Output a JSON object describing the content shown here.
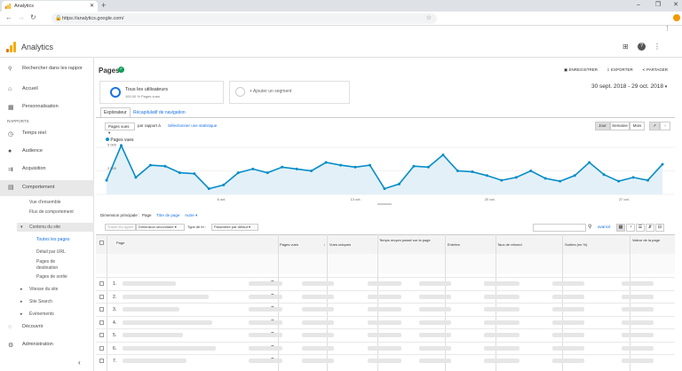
{
  "browser": {
    "tab_title": "Analytics",
    "new_tab": "+",
    "url": "https://analytics.google.com/"
  },
  "header": {
    "app_name": "Analytics"
  },
  "sidebar": {
    "search_placeholder": "Rechercher dans les rappor",
    "items": {
      "accueil": "Accueil",
      "personnalisation": "Personnalisation",
      "section_rapports": "RAPPORTS",
      "temps_reel": "Temps réel",
      "audience": "Audience",
      "acquisition": "Acquisition",
      "comportement": "Comportement",
      "vue_ensemble": "Vue d'ensemble",
      "flux_comportement": "Flux de comportement",
      "contenu_site": "Contenu du site",
      "toutes_pages": "Toutes les pages",
      "detail_url": "Détail par URL",
      "pages_destination": "Pages de destination",
      "pages_sortie": "Pages de sortie",
      "vitesse_site": "Vitesse du site",
      "site_search": "Site Search",
      "evenements": "Événements",
      "decouvrir": "Découvrir",
      "administration": "Administration"
    },
    "collapse": "‹"
  },
  "main": {
    "title": "Pages",
    "actions": {
      "enregistrer": "ENREGISTRER",
      "exporter": "EXPORTER",
      "partager": "PARTAGER"
    },
    "segment": {
      "name": "Tous les utilisateurs",
      "detail": "100,00 % Pages vues",
      "add": "+ Ajouter un segment"
    },
    "date_range": "30 sept. 2018 - 29 oct. 2018",
    "tabs": {
      "explorateur": "Explorateur",
      "recapitulatif": "Récapitulatif de navigation"
    },
    "controls": {
      "metric": "Pages vues",
      "par_rapport": "par rapport à",
      "select_stat": "Sélectionner une statistique",
      "jour": "Jour",
      "semaine": "Semaine",
      "mois": "Mois"
    },
    "dimension": {
      "label": "Dimension principale :",
      "page": "Page",
      "titre": "Titre de page",
      "autre": "Autre"
    },
    "filters": {
      "tracer": "Tracer les lignes",
      "secondaire": "Dimension secondaire",
      "type_tri": "Type de tri :",
      "parametre": "Paramètre par défaut",
      "avance": "avancé"
    },
    "table": {
      "headers": {
        "page": "Page",
        "pages_vues": "Pages vues",
        "vues_uniques": "Vues uniques",
        "temps_moyen": "Temps moyen passé sur la page",
        "entrees": "Entrées",
        "taux_rebond": "Taux de rebond",
        "sorties": "Sorties (en %)",
        "valeur": "Valeur de la page"
      },
      "rows": [
        "1.",
        "2.",
        "3.",
        "4.",
        "5.",
        "6.",
        "7."
      ]
    }
  },
  "chart_data": {
    "type": "line",
    "series": [
      {
        "name": "Pages vues",
        "values": [
          1500,
          5200,
          1800,
          3100,
          3000,
          2300,
          2200,
          600,
          1000,
          2300,
          2700,
          2300,
          2900,
          2700,
          2500,
          3400,
          3100,
          2900,
          3100,
          600,
          1100,
          3000,
          2900,
          4200,
          2500,
          2400,
          2000,
          1500,
          1800,
          2500,
          1700,
          1400,
          2000,
          3400,
          2100,
          1400,
          1800,
          1500,
          3200
        ]
      }
    ],
    "x_tick_labels": [
      "6 oct.",
      "13 oct.",
      "20 oct.",
      "27 oct."
    ],
    "y_tick_labels": [
      "5 000",
      "2 500"
    ],
    "ylim": [
      0,
      5000
    ],
    "color": "#058dc7"
  },
  "colors": {
    "accent": "#1a73e8",
    "series": "#058dc7",
    "segment_ring": "#1a73e8",
    "logo": [
      "#f9ab00",
      "#e37400",
      "#f9ab00"
    ]
  }
}
